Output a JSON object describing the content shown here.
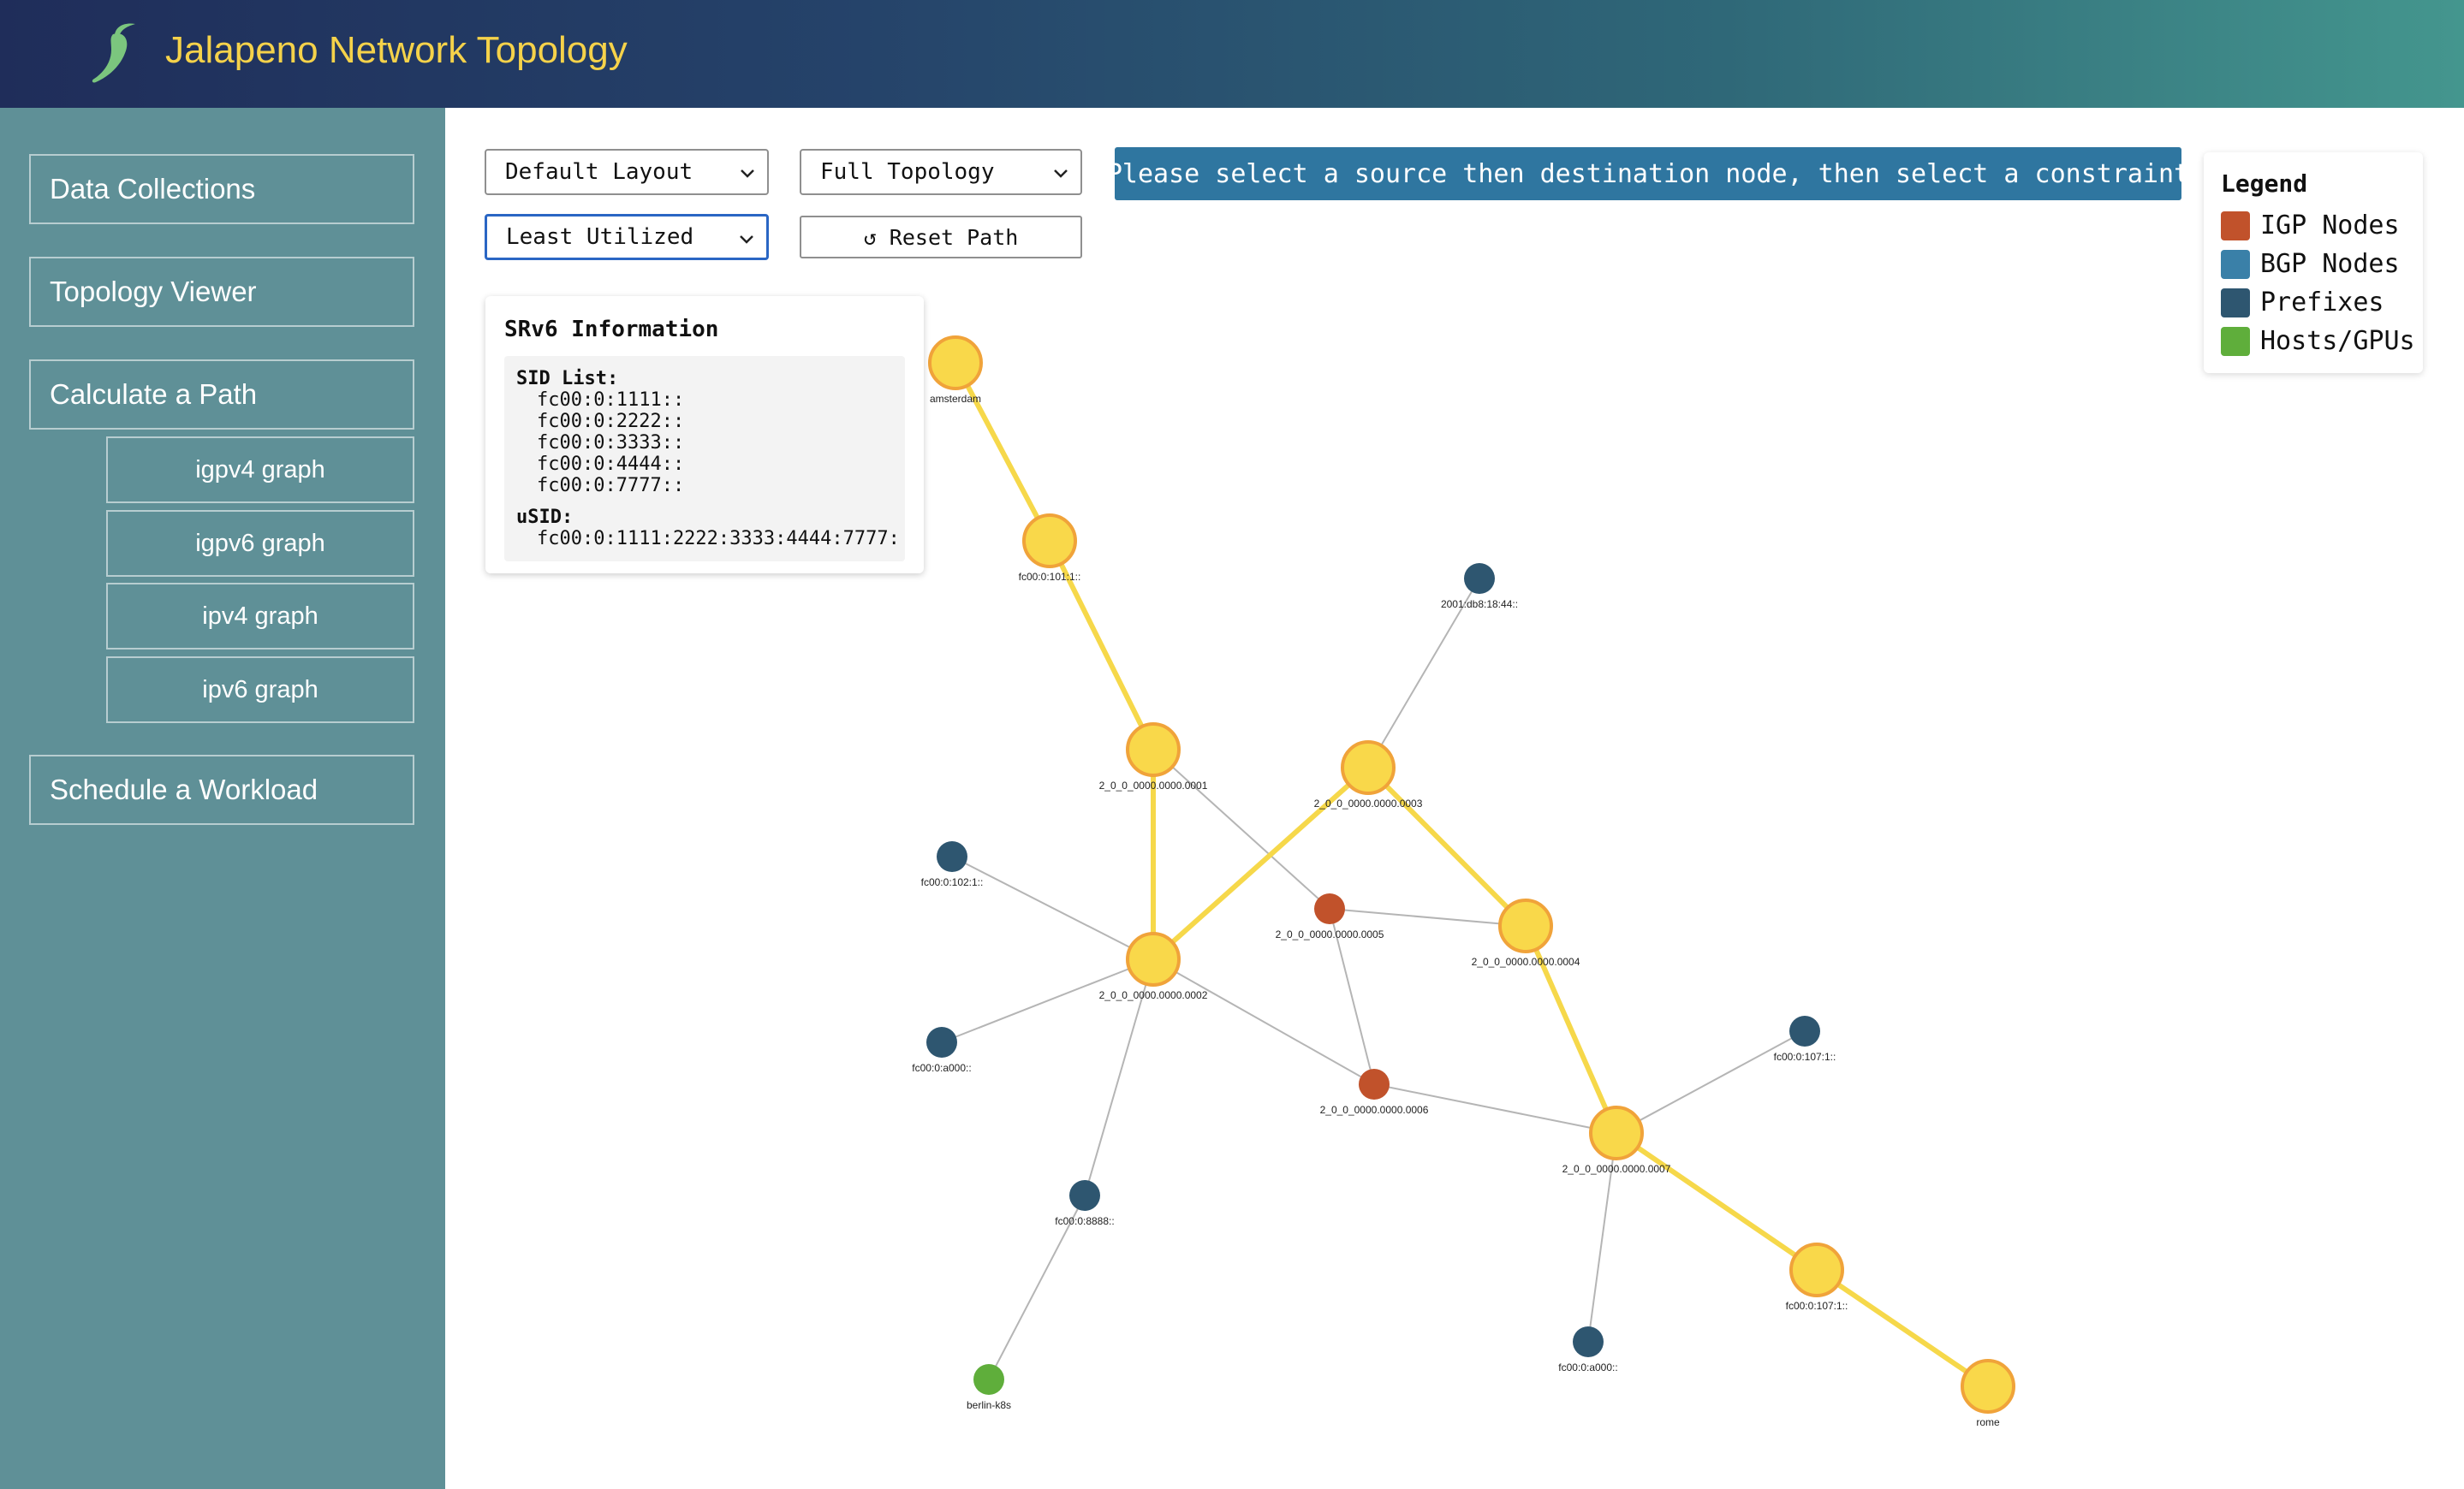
{
  "header": {
    "title": "Jalapeno Network Topology",
    "logo_icon": "jalapeno-pepper-icon"
  },
  "sidebar": {
    "items": [
      {
        "label": "Data Collections"
      },
      {
        "label": "Topology Viewer"
      },
      {
        "label": "Calculate a Path"
      },
      {
        "label": "Schedule a Workload"
      }
    ],
    "subitems": [
      {
        "label": "igpv4 graph"
      },
      {
        "label": "igpv6 graph"
      },
      {
        "label": "ipv4 graph"
      },
      {
        "label": "ipv6 graph"
      }
    ]
  },
  "controls": {
    "layout_select": "Default Layout",
    "topology_select": "Full Topology",
    "constraint_select": "Least Utilized",
    "reset_label": "↺ Reset Path"
  },
  "instruction": "Please select a source then destination node, then select a constraint",
  "legend": {
    "title": "Legend",
    "items": [
      {
        "label": "IGP Nodes",
        "color": "#c1522b"
      },
      {
        "label": "BGP Nodes",
        "color": "#3a80a8"
      },
      {
        "label": "Prefixes",
        "color": "#2e5670"
      },
      {
        "label": "Hosts/GPUs",
        "color": "#5fae3b"
      }
    ]
  },
  "srv6": {
    "title": "SRv6 Information",
    "sid_list_label": "SID List:",
    "sids": [
      "fc00:0:1111::",
      "fc00:0:2222::",
      "fc00:0:3333::",
      "fc00:0:4444::",
      "fc00:0:7777::"
    ],
    "usid_label": "uSID:",
    "usid": "fc00:0:1111:2222:3333:4444:7777:"
  },
  "colors": {
    "path_node": "#f9d84a",
    "path_node_stroke": "#f0a33a",
    "path_edge": "#f6d84a",
    "edge": "#b5b5b5"
  },
  "graph": {
    "nodes": [
      {
        "id": "amsterdam",
        "label": "amsterdam",
        "type": "path"
      },
      {
        "id": "n101",
        "label": "fc00:0:101:1::",
        "type": "path"
      },
      {
        "id": "n2001",
        "label": "2001:db8:18:44::",
        "type": "prefix"
      },
      {
        "id": "n0001",
        "label": "2_0_0_0000.0000.0001",
        "type": "path"
      },
      {
        "id": "n0003",
        "label": "2_0_0_0000.0000.0003",
        "type": "path"
      },
      {
        "id": "n102",
        "label": "fc00:0:102:1::",
        "type": "prefix"
      },
      {
        "id": "n0005",
        "label": "2_0_0_0000.0000.0005",
        "type": "igp"
      },
      {
        "id": "n0004",
        "label": "2_0_0_0000.0000.0004",
        "type": "path"
      },
      {
        "id": "n0002",
        "label": "2_0_0_0000.0000.0002",
        "type": "path"
      },
      {
        "id": "na000a",
        "label": "fc00:0:a000::",
        "type": "prefix"
      },
      {
        "id": "n107",
        "label": "fc00:0:107:1::",
        "type": "prefix"
      },
      {
        "id": "n0006",
        "label": "2_0_0_0000.0000.0006",
        "type": "igp"
      },
      {
        "id": "n0007",
        "label": "2_0_0_0000.0000.0007",
        "type": "path"
      },
      {
        "id": "n8888",
        "label": "fc00:0:8888::",
        "type": "prefix"
      },
      {
        "id": "n107b",
        "label": "fc00:0:107:1::",
        "type": "path"
      },
      {
        "id": "na000b",
        "label": "fc00:0:a000::",
        "type": "prefix"
      },
      {
        "id": "berlin",
        "label": "berlin-k8s",
        "type": "host"
      },
      {
        "id": "rome",
        "label": "rome",
        "type": "path"
      }
    ],
    "edges": [
      {
        "s": "amsterdam",
        "t": "n101",
        "path": true
      },
      {
        "s": "n101",
        "t": "n0001",
        "path": true
      },
      {
        "s": "n0001",
        "t": "n0002",
        "path": true
      },
      {
        "s": "n0002",
        "t": "n0003",
        "path": true
      },
      {
        "s": "n0003",
        "t": "n0004",
        "path": true
      },
      {
        "s": "n0004",
        "t": "n0007",
        "path": true
      },
      {
        "s": "n0007",
        "t": "n107b",
        "path": true
      },
      {
        "s": "n107b",
        "t": "rome",
        "path": true
      },
      {
        "s": "n2001",
        "t": "n0003",
        "path": false
      },
      {
        "s": "n0001",
        "t": "n0005",
        "path": false
      },
      {
        "s": "n0005",
        "t": "n0004",
        "path": false
      },
      {
        "s": "n0005",
        "t": "n0006",
        "path": false
      },
      {
        "s": "n102",
        "t": "n0002",
        "path": false
      },
      {
        "s": "na000a",
        "t": "n0002",
        "path": false
      },
      {
        "s": "n0002",
        "t": "n0006",
        "path": false
      },
      {
        "s": "n0002",
        "t": "n8888",
        "path": false
      },
      {
        "s": "n0006",
        "t": "n0007",
        "path": false
      },
      {
        "s": "n107",
        "t": "n0007",
        "path": false
      },
      {
        "s": "n0007",
        "t": "na000b",
        "path": false
      },
      {
        "s": "n8888",
        "t": "berlin",
        "path": false
      }
    ]
  }
}
